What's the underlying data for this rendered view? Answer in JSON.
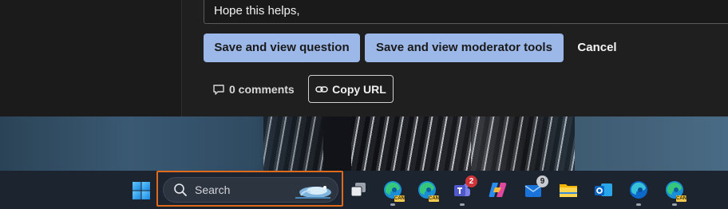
{
  "editor": {
    "reply_text": "Hope this helps,"
  },
  "actions": {
    "save_question_label": "Save and view question",
    "save_moderator_label": "Save and view moderator tools",
    "cancel_label": "Cancel"
  },
  "footer_links": {
    "comments_label": "0 comments",
    "copy_url_label": "Copy URL"
  },
  "taskbar": {
    "search_placeholder": "Search",
    "badges": {
      "teams": "2",
      "mail": "9"
    },
    "can_tag": "CAN",
    "items": [
      {
        "icon": "task-view-icon"
      },
      {
        "icon": "edge-canary-icon"
      },
      {
        "icon": "edge-canary-icon"
      },
      {
        "icon": "teams-icon"
      },
      {
        "icon": "copilot-icon"
      },
      {
        "icon": "mail-icon"
      },
      {
        "icon": "file-explorer-icon"
      },
      {
        "icon": "outlook-icon"
      },
      {
        "icon": "edge-icon"
      },
      {
        "icon": "edge-canary-icon"
      }
    ]
  },
  "colors": {
    "primary_button": "#9cb8e8",
    "highlight_border": "#e06a1b",
    "taskbar_bg": "#1c2430",
    "badge_red": "#d13438"
  }
}
